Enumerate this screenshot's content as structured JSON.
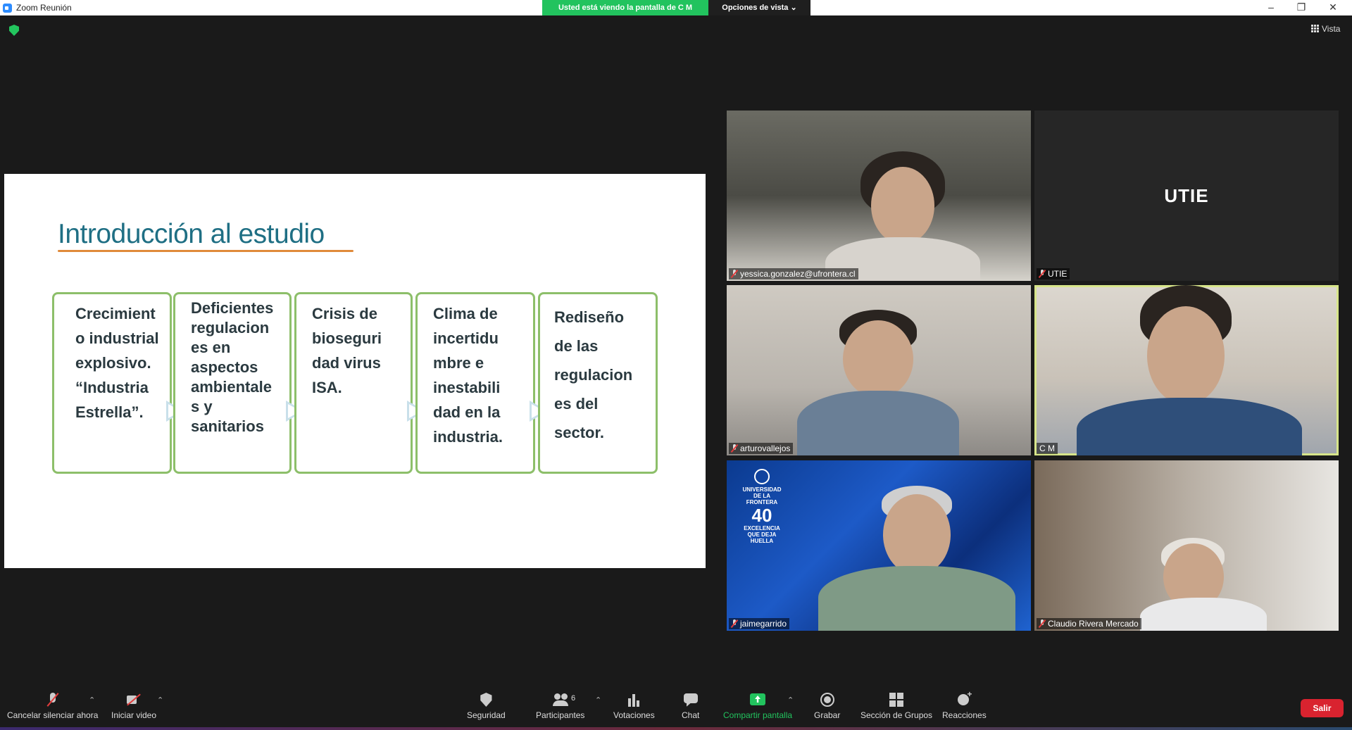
{
  "window": {
    "title": "Zoom Reunión",
    "viewing_banner": "Usted está viendo la pantalla de C M",
    "view_options": "Opciones de vista",
    "view_button": "Vista"
  },
  "slide": {
    "title": "Introducción al estudio",
    "steps": [
      {
        "text": "Crecimient\no industrial\nexplosivo.\n“Industria\nEstrella”."
      },
      {
        "text": "Deficientes\nregulacion\nes en\naspectos\nambientale\ns y\nsanitarios"
      },
      {
        "text": "Crisis  de\nbioseguri\ndad virus\nISA."
      },
      {
        "text": "Clima de\nincertidu\nmbre e\ninestabili\ndad en la\nindustria."
      },
      {
        "text": "Rediseño\nde las\nregulacion\nes del\nsector."
      }
    ]
  },
  "participants": [
    {
      "name": "yessica.gonzalez@ufrontera.cl",
      "muted": true
    },
    {
      "name": "UTIE",
      "muted": true,
      "display_text": "UTIE"
    },
    {
      "name": "arturovallejos",
      "muted": true
    },
    {
      "name": "C M",
      "muted": false,
      "active_speaker": true
    },
    {
      "name": "jaimegarrido",
      "muted": true
    },
    {
      "name": "Claudio Rivera Mercado",
      "muted": true
    }
  ],
  "ufro_logo": {
    "line1": "UNIVERSIDAD",
    "line2": "DE LA FRONTERA",
    "years": "40",
    "motto1": "EXCELENCIA",
    "motto2": "QUE DEJA",
    "motto3": "HUELLA"
  },
  "toolbar": {
    "mute": "Cancelar silenciar ahora",
    "video": "Iniciar video",
    "security": "Seguridad",
    "participants": "Participantes",
    "participants_count": "6",
    "polls": "Votaciones",
    "chat": "Chat",
    "share": "Compartir pantalla",
    "record": "Grabar",
    "breakout": "Sección de Grupos",
    "reactions": "Reacciones",
    "leave": "Salir"
  },
  "colors": {
    "viewing_banner": "#22c35e",
    "leave": "#d9232f",
    "active_speaker_border": "#d7e58a",
    "slide_title": "#1f6f84",
    "step_border": "#8dbf6a"
  }
}
